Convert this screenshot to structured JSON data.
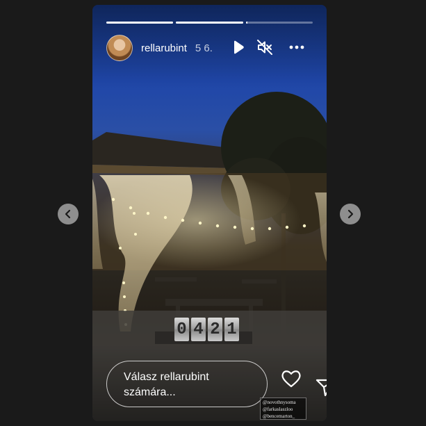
{
  "story": {
    "username": "rellarubint",
    "timestamp": "5 6.",
    "progress": [
      1.0,
      1.0,
      0.02
    ],
    "counter_digits": [
      "0",
      "4",
      "2",
      "1"
    ],
    "reply_placeholder": "Válasz rellarubint számára...",
    "tag_sticker": [
      "@novothnysoma",
      "@farkaslaszloo",
      "@bencemarton_"
    ]
  },
  "icons": {
    "play": "play-icon",
    "mute": "speaker-muted-icon",
    "more": "more-horizontal-icon",
    "like": "heart-icon",
    "share": "send-icon",
    "prev": "chevron-left-icon",
    "next": "chevron-right-icon"
  },
  "colors": {
    "background": "#1a1a1a",
    "nav_button": "#8e8e8e",
    "text": "#ffffff"
  }
}
